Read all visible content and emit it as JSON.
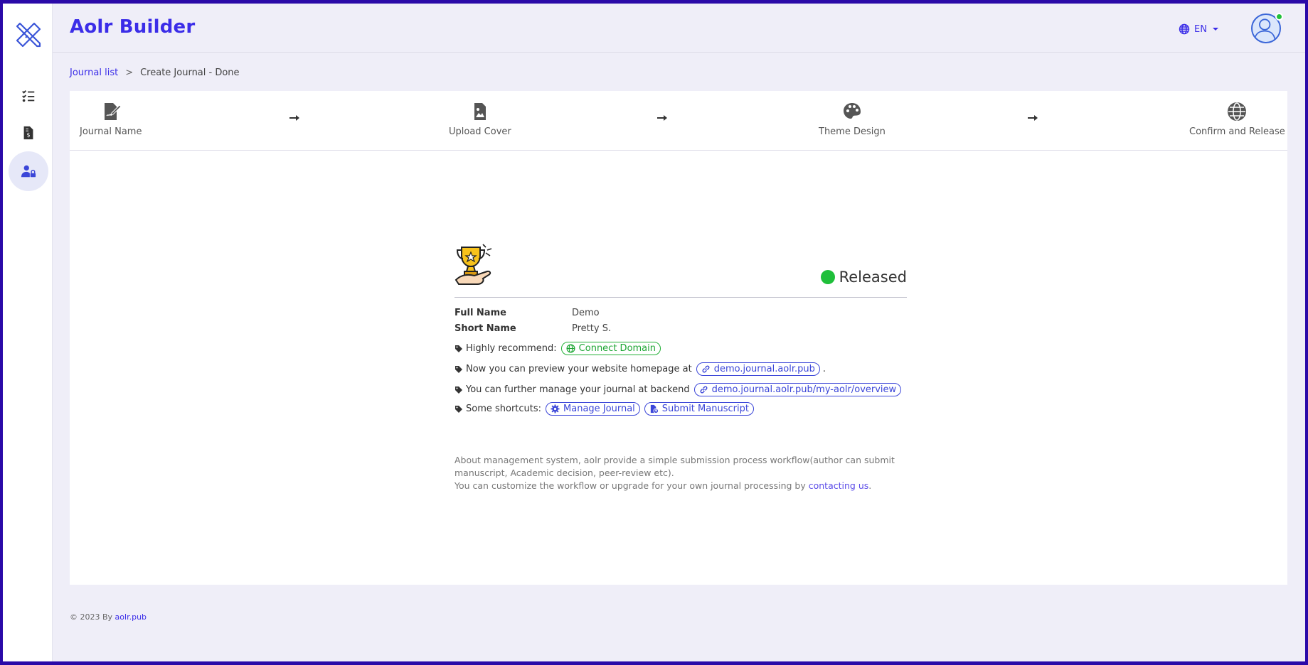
{
  "app": {
    "title": "Aolr Builder"
  },
  "sidebar": {
    "logo_icon": "pencil-ruler-icon",
    "items": [
      {
        "name": "task-list",
        "icon": "list-check-icon",
        "active": false
      },
      {
        "name": "invoice",
        "icon": "file-invoice-dollar-icon",
        "active": false
      },
      {
        "name": "user-lock",
        "icon": "user-lock-icon",
        "active": true
      }
    ]
  },
  "header": {
    "language": "EN",
    "language_icon": "globe-icon",
    "avatar_icon": "user-avatar-icon",
    "online_color": "#21c03a"
  },
  "breadcrumb": {
    "parent": "Journal list",
    "separator": ">",
    "current": "Create Journal - Done"
  },
  "steps": [
    {
      "label": "Journal Name",
      "icon": "file-signature-icon"
    },
    {
      "label": "Upload Cover",
      "icon": "file-image-icon"
    },
    {
      "label": "Theme Design",
      "icon": "palette-icon"
    },
    {
      "label": "Confirm and Release",
      "icon": "globe-icon"
    }
  ],
  "result": {
    "status": "Released",
    "status_color": "#1fbf3a",
    "full_name_label": "Full Name",
    "full_name": "Demo",
    "short_name_label": "Short Name",
    "short_name": "Pretty S.",
    "recommend_text": "Highly recommend:",
    "connect_domain": "Connect Domain",
    "preview_text": "Now you can preview your website homepage at",
    "preview_link": "demo.journal.aolr.pub",
    "preview_suffix": ".",
    "manage_text": "You can further manage your journal at backend",
    "manage_link": "demo.journal.aolr.pub/my-aolr/overview",
    "shortcuts_text": "Some shortcuts:",
    "manage_journal": "Manage Journal",
    "submit_manuscript": "Submit Manuscript",
    "note_line1": "About management system, aolr provide a simple submission process workflow(author can submit manuscript, Academic decision, peer-review etc).",
    "note_line2": "You can customize the workflow or upgrade for your own journal processing by",
    "note_link": "contacting us",
    "note_end": "."
  },
  "footer": {
    "text": "© 2023 By",
    "link": "aolr.pub"
  },
  "colors": {
    "accent": "#3b2de8",
    "success": "#1fbf3a",
    "frame": "#2a0aa8"
  }
}
